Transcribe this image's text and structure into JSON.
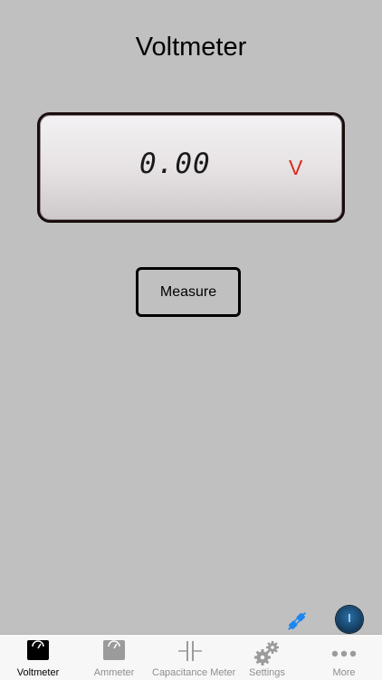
{
  "page": {
    "title": "Voltmeter"
  },
  "display": {
    "reading": "0.00",
    "unit": "V",
    "unit_color": "#d82d1c"
  },
  "actions": {
    "measure_label": "Measure"
  },
  "status": {
    "connection_icon": "plug-connect-icon",
    "indicator_icon": "status-dial-icon"
  },
  "tabbar": {
    "active_index": 0,
    "tabs": [
      {
        "label": "Voltmeter",
        "icon": "voltmeter-icon"
      },
      {
        "label": "Ammeter",
        "icon": "ammeter-icon"
      },
      {
        "label": "Capacitance Meter",
        "icon": "capacitor-icon"
      },
      {
        "label": "Settings",
        "icon": "gears-icon"
      },
      {
        "label": "More",
        "icon": "more-dots-icon"
      }
    ]
  }
}
